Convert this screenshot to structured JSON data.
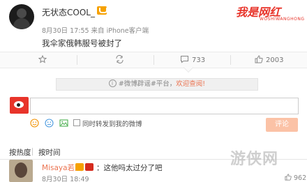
{
  "post": {
    "username": "无状态COOL_",
    "meta": "8月30日 17:55 来自 iPhone客户端",
    "content": "我伞家俄韩服号被封了"
  },
  "watermark": {
    "main": "我是网红",
    "sub": "WOSHIWANGHONG"
  },
  "actions": {
    "comment_count": "733",
    "like_count": "2003"
  },
  "notice": {
    "prefix": "#微博辟谣#平台，",
    "link": "欢迎查阅!"
  },
  "comment_box": {
    "input_value": "",
    "repost_label": "同时转发到我的微博",
    "submit_label": "评论"
  },
  "sort": {
    "hot": "按热度",
    "time": "按时间"
  },
  "comments": [
    {
      "username": "Misaya若风",
      "text": "：这他吗太过分了吧",
      "time": "8月30日 18:49",
      "likes": "962"
    }
  ],
  "site_mark": "游侠网",
  "colors": {
    "accent": "#eb7350",
    "brand_red": "#e8342a",
    "submit_disabled": "#fbc2a6"
  }
}
